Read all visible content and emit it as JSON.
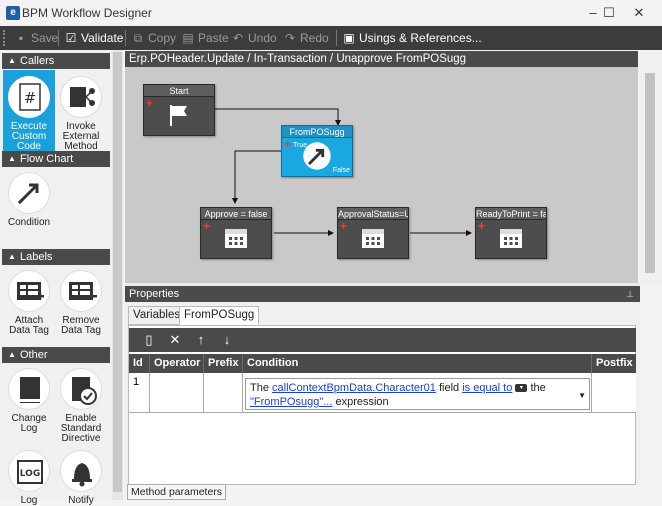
{
  "window": {
    "title": "BPM Workflow Designer",
    "app_icon": "e",
    "minimize": "–",
    "maximize": "☐",
    "close": "✕"
  },
  "toolbar": {
    "save": "Save",
    "validate": "Validate",
    "copy": "Copy",
    "paste": "Paste",
    "undo": "Undo",
    "redo": "Redo",
    "usings": "Usings & References..."
  },
  "sidebar": {
    "categories": {
      "callers": "Callers",
      "flow_chart": "Flow Chart",
      "labels": "Labels",
      "other": "Other"
    },
    "tools": {
      "execute_custom_code": "Execute Custom Code",
      "invoke_external_method": "Invoke External Method",
      "condition": "Condition",
      "attach_data_tag": "Attach Data Tag",
      "remove_data_tag": "Remove Data Tag",
      "change_log": "Change Log",
      "enable_standard_directive": "Enable Standard Directive",
      "log": "Log",
      "notify": "Notify"
    },
    "log_icon_text": "LOG"
  },
  "canvas": {
    "header": "Erp.POHeader.Update / In-Transaction / Unapprove FromPOSugg",
    "nodes": {
      "start": "Start",
      "frompo": "FromPOSugg",
      "frompo_true": "True",
      "frompo_false": "False",
      "approve": "Approve = false",
      "approval_status": "ApprovalStatus=U",
      "ready_to_print": "ReadyToPrint = fals"
    }
  },
  "properties": {
    "header": "Properties",
    "tabs": {
      "variables": "Variables",
      "frompo": "FromPOSugg"
    },
    "columns": {
      "id": "Id",
      "operator": "Operator",
      "prefix": "Prefix",
      "condition": "Condition",
      "postfix": "Postfix"
    },
    "row": {
      "id": "1",
      "cond_prefix": "The",
      "cond_field": "callContextBpmData.Character01",
      "cond_field_word": "field",
      "cond_operator": "is equal to",
      "cond_the": "the",
      "cond_value": "\"FromPOsugg\"...",
      "cond_suffix": "expression"
    },
    "bottom_tab": "Method parameters"
  },
  "colors": {
    "accent": "#1aa0dc",
    "dark": "#4a4a4a",
    "link": "#1a3fd6"
  }
}
